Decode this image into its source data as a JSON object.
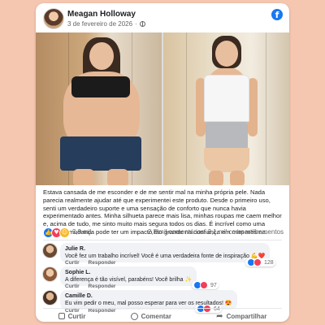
{
  "post": {
    "author": "Meagan Holloway",
    "date": "3 de fevereiro de 2026",
    "date_separator": "·",
    "caption": "Estava cansada de me esconder e de me sentir mal na minha própria pele. Nada parecia realmente ajudar até que experimentei este produto. Desde o primeiro uso, senti um verdadeiro suporte e uma sensação de conforto que nunca havia experimentado antes. Minha silhueta parece mais lisa, minhas roupas me caem melhor e, acima de tudo, me sinto muito mais segura todos os dias. É incrível como uma pequena mudança pode ter um impacto tão grande na confiança em mim mesma."
  },
  "stats": {
    "reactions": "3,9 mil",
    "comments": "2,8 mil comentários",
    "shares": "3,1 mil compartilhamentos"
  },
  "comments": [
    {
      "name": "Julie R.",
      "text": "Você fez um trabalho incrível! Você é uma verdadeira fonte de inspiração 💪❤️",
      "like": "Curtir",
      "reply": "Responder",
      "count": "128"
    },
    {
      "name": "Sophie L.",
      "text": "A diferença é tão visível, parabéns! Você brilha ✨",
      "like": "Curtir",
      "reply": "Responder",
      "count": "97"
    },
    {
      "name": "Camille D.",
      "text": "Eu vim pedir o meu, mal posso esperar para ver os resultados! 😍",
      "like": "Curtir",
      "reply": "Responder",
      "count": "64"
    }
  ],
  "actions": {
    "like": "Curtir",
    "comment": "Comentar",
    "share": "Compartilhar"
  },
  "icons": {
    "platform": "facebook-icon",
    "privacy": "globe-icon"
  },
  "colors": {
    "background": "#f6c7b0",
    "brand": "#1877f2"
  }
}
